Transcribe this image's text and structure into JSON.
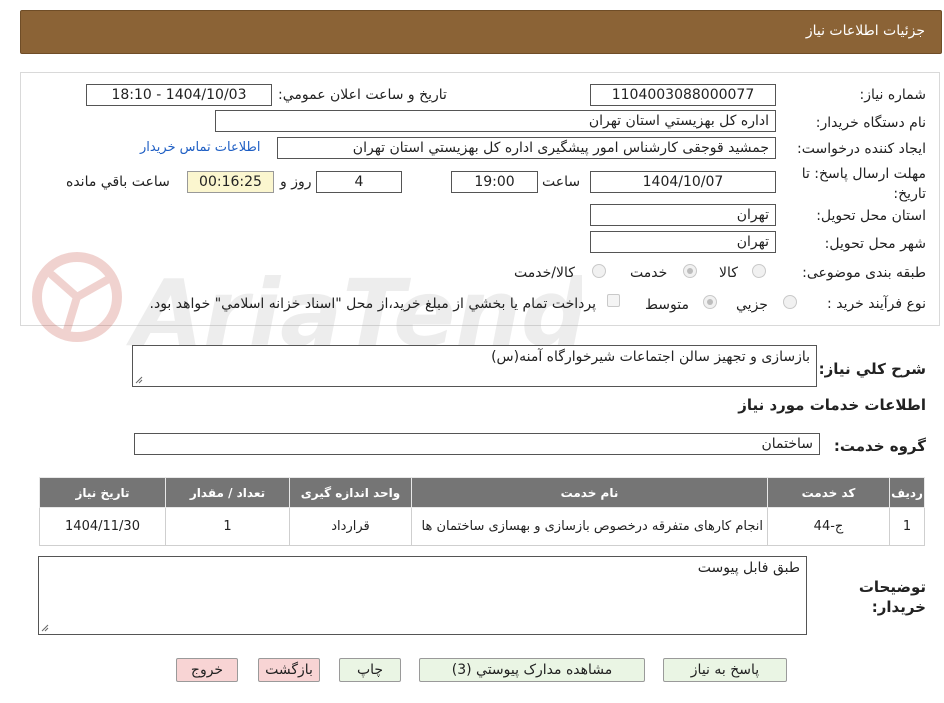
{
  "header": {
    "title": "جزئیات اطلاعات نیاز"
  },
  "form": {
    "need_number_label": "شماره نیاز:",
    "need_number": "1104003088000077",
    "announce_label": "تاریخ و ساعت اعلان عمومي:",
    "announce_value": "1404/10/03 - 18:10",
    "buyer_org_label": "نام دستگاه خريدار:",
    "buyer_org": "اداره کل بهزيستي استان تهران",
    "requester_label": "ايجاد کننده درخواست:",
    "requester": "جمشید قوجقی کارشناس امور پیشگیری اداره کل بهزيستي استان تهران",
    "contact_link": "اطلاعات تماس خريدار",
    "deadline_label": "مهلت ارسال پاسخ: تا تاريخ:",
    "deadline_date": "1404/10/07",
    "time_label": "ساعت",
    "deadline_time": "19:00",
    "days_value": "4",
    "days_label": "روز و",
    "remaining_value": "00:16:25",
    "remaining_label": "ساعت باقي مانده",
    "province_label": "استان محل تحويل:",
    "province": "تهران",
    "city_label": "شهر محل تحويل:",
    "city": "تهران",
    "category_label": "طبقه بندی موضوعی:",
    "category_options": [
      "کالا",
      "خدمت",
      "کالا/خدمت"
    ],
    "process_label": "نوع فرآيند خريد :",
    "process_options": [
      "جزيي",
      "متوسط"
    ],
    "process_note": "پرداخت تمام يا بخشي از مبلغ خريد،از محل \"اسناد خزانه اسلامي\" خواهد بود."
  },
  "summary": {
    "label": "شرح کلي نياز:",
    "value": "بازسازی و تجهیز سالن اجتماعات شیرخوارگاه آمنه(س)"
  },
  "services": {
    "section_title": "اطلاعات خدمات مورد نياز",
    "group_label": "گروه خدمت:",
    "group_value": "ساختمان",
    "columns": [
      "رديف",
      "کد خدمت",
      "نام خدمت",
      "واحد اندازه گيری",
      "تعداد / مقدار",
      "تاريخ نياز"
    ],
    "rows": [
      [
        "1",
        "ج-44",
        "انجام کارهای متفرقه درخصوص بازسازی و بهسازی ساختمان ها",
        "قرارداد",
        "1",
        "1404/11/30"
      ]
    ]
  },
  "notes": {
    "label": "توضيحات خريدار:",
    "value": "طبق فابل پیوست"
  },
  "buttons": {
    "reply": "پاسخ به نياز",
    "attachments": "مشاهده مدارک پيوستي (3)",
    "print": "چاپ",
    "back": "بازگشت",
    "exit": "خروج"
  },
  "watermark": {
    "text": "AriaTender.neT"
  },
  "colors": {
    "header": "#8b6336",
    "table_header": "#757575",
    "button_green": "#eaf5e4",
    "button_red": "#f8d4d4",
    "remaining_bg": "#fbf6cf",
    "link": "#1f5fc4"
  }
}
